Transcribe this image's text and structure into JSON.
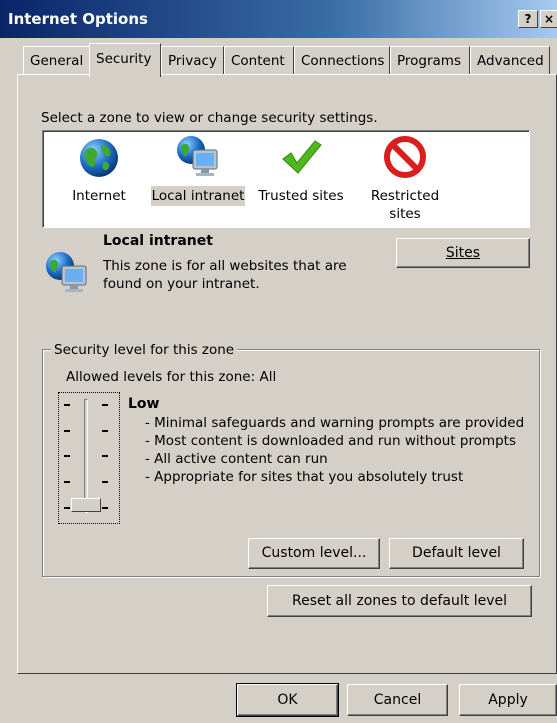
{
  "window": {
    "title": "Internet Options",
    "help_glyph": "?",
    "close_glyph": "×"
  },
  "tabs": [
    {
      "label": "General",
      "active": false
    },
    {
      "label": "Security",
      "active": true
    },
    {
      "label": "Privacy",
      "active": false
    },
    {
      "label": "Content",
      "active": false
    },
    {
      "label": "Connections",
      "active": false
    },
    {
      "label": "Programs",
      "active": false
    },
    {
      "label": "Advanced",
      "active": false
    }
  ],
  "security": {
    "instruction": "Select a zone to view or change security settings.",
    "zones": [
      {
        "label": "Internet",
        "icon": "globe-icon"
      },
      {
        "label": "Local intranet",
        "icon": "local-intranet-icon",
        "selected": true
      },
      {
        "label": "Trusted sites",
        "icon": "checkmark-icon"
      },
      {
        "label_line1": "Restricted",
        "label_line2": "sites",
        "icon": "restricted-icon"
      }
    ],
    "selected_zone": {
      "name": "Local intranet",
      "description_line1": "This zone is for all websites that are",
      "description_line2": "found on your intranet."
    },
    "sites_button": "Sites"
  },
  "level_group": {
    "legend": "Security level for this zone",
    "allowed": "Allowed levels for this zone: All",
    "level_name": "Low",
    "level_value": "Low",
    "bullets": [
      "- Minimal safeguards and warning prompts are provided",
      "- Most content is downloaded and run without prompts",
      "- All active content can run",
      "- Appropriate for sites that you absolutely trust"
    ],
    "custom_level_button": "Custom level...",
    "default_level_button": "Default level"
  },
  "reset_button": "Reset all zones to default level",
  "footer": {
    "ok": "OK",
    "cancel": "Cancel",
    "apply": "Apply"
  },
  "colors": {
    "title_bar_start": "#0a246a",
    "title_bar_end": "#a6caf0",
    "dialog_face": "#d4d0c8",
    "restricted_red": "#d91e1e",
    "trusted_green": "#4fb81f"
  }
}
